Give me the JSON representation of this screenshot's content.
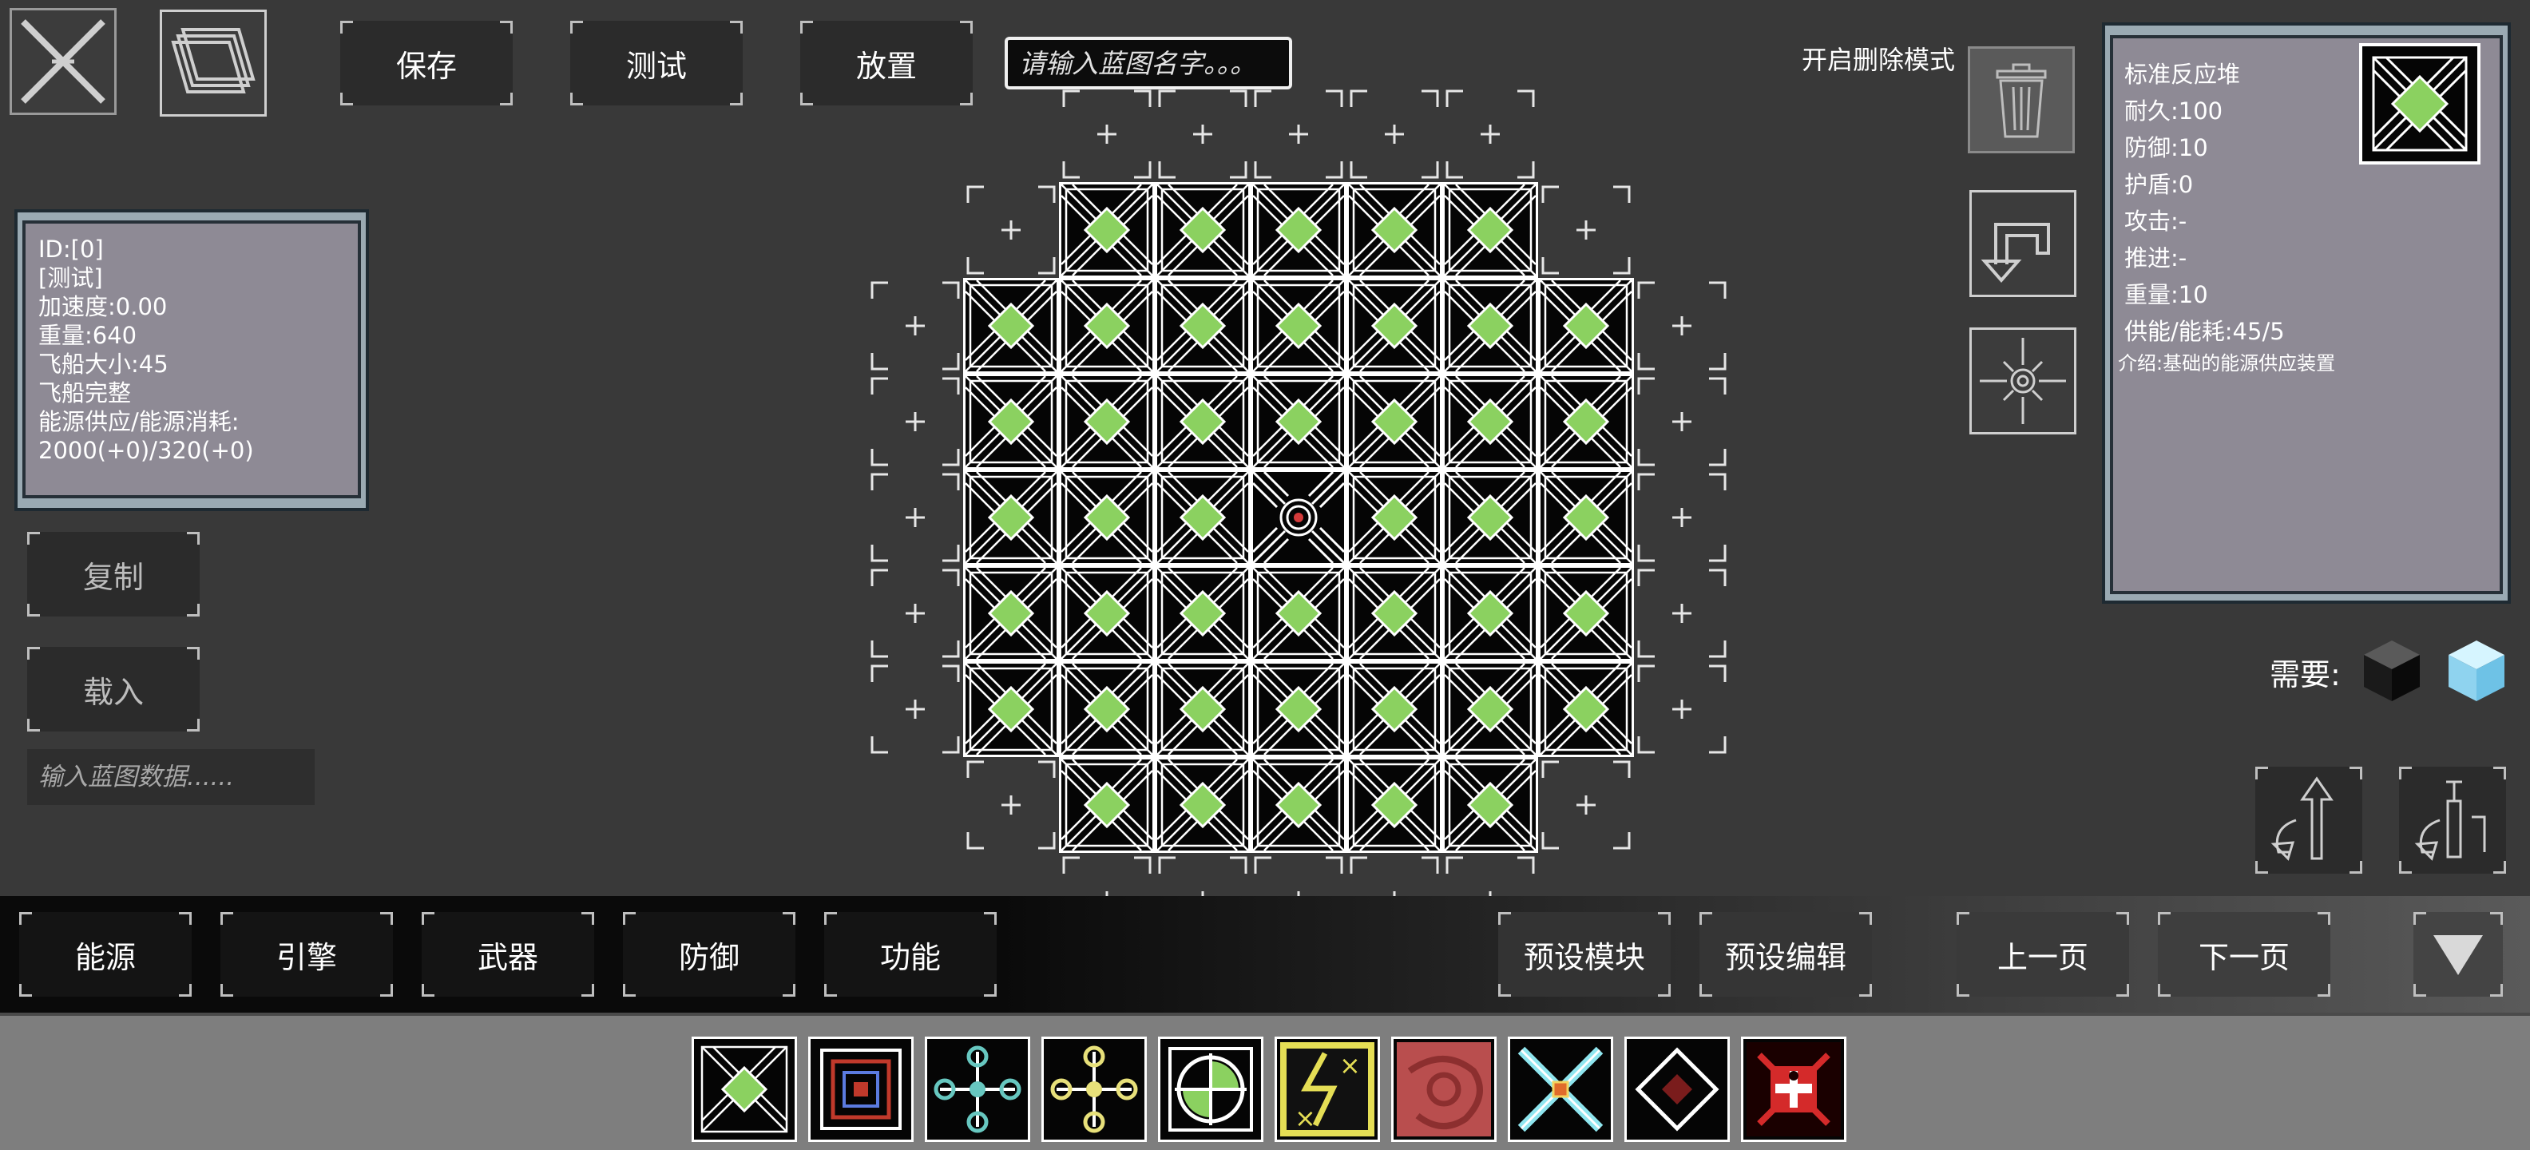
{
  "toolbar": {
    "save_label": "保存",
    "test_label": "测试",
    "place_label": "放置",
    "name_placeholder": "请输入蓝图名字。。。"
  },
  "ship_info": {
    "lines": [
      "ID:[0]",
      "[测试]",
      "加速度:0.00",
      "重量:640",
      "飞船大小:45",
      "飞船完整",
      "能源供应/能源消耗:",
      "2000(+0)/320(+0)"
    ]
  },
  "blueprint": {
    "copy_label": "复制",
    "load_label": "载入",
    "data_placeholder": "输入蓝图数据......"
  },
  "delete_mode": {
    "label": "开启删除模式"
  },
  "module_info": {
    "lines": [
      "标准反应堆",
      "耐久:100",
      "防御:10",
      "护盾:0",
      "攻击:-",
      "推进:-",
      "重量:10",
      "供能/能耗:45/5"
    ],
    "intro": "介绍:基础的能源供应装置"
  },
  "requires": {
    "label": "需要:"
  },
  "categories": [
    {
      "label": "能源"
    },
    {
      "label": "引擎"
    },
    {
      "label": "武器"
    },
    {
      "label": "防御"
    },
    {
      "label": "功能"
    }
  ],
  "preset": {
    "module_label": "预设模块",
    "edit_label": "预设编辑"
  },
  "paging": {
    "prev_label": "上一页",
    "next_label": "下一页"
  },
  "grid": {
    "rows": [
      ".SSSSS.",
      "SRRRRRS",
      "RRRRRRR",
      "RRRRRRR",
      "RRRCRRR",
      "RRRRRRR",
      "RRRRRRR",
      "SRRRRRS",
      ".SSSSS."
    ],
    "extra_left_slots": [
      1,
      2,
      3,
      4,
      5
    ],
    "extra_right_slots": [
      1,
      2,
      3,
      4,
      5
    ]
  },
  "palette": [
    {
      "icon": "standard-reactor-icon",
      "accent": "#8bd160"
    },
    {
      "icon": "red-blue-square-module-icon",
      "accent": "#c0392b"
    },
    {
      "icon": "teal-cross-module-icon",
      "accent": "#67c7c0"
    },
    {
      "icon": "yellow-cross-module-icon",
      "accent": "#e7e07a"
    },
    {
      "icon": "green-circle-module-icon",
      "accent": "#8bd160"
    },
    {
      "icon": "yellow-lightning-module-icon",
      "accent": "#e5de55"
    },
    {
      "icon": "red-pattern-module-icon",
      "accent": "#b94e4e"
    },
    {
      "icon": "cyan-x-module-icon",
      "accent": "#8fe6ef"
    },
    {
      "icon": "red-diamond-module-icon",
      "accent": "#7a1c1c"
    },
    {
      "icon": "red-skull-module-icon",
      "accent": "#d42a2a"
    }
  ],
  "colors": {
    "background": "#393939",
    "reactor_core": "#8bd160",
    "panel_fill": "#8e8a95",
    "panel_frame": "#9aaab3"
  }
}
